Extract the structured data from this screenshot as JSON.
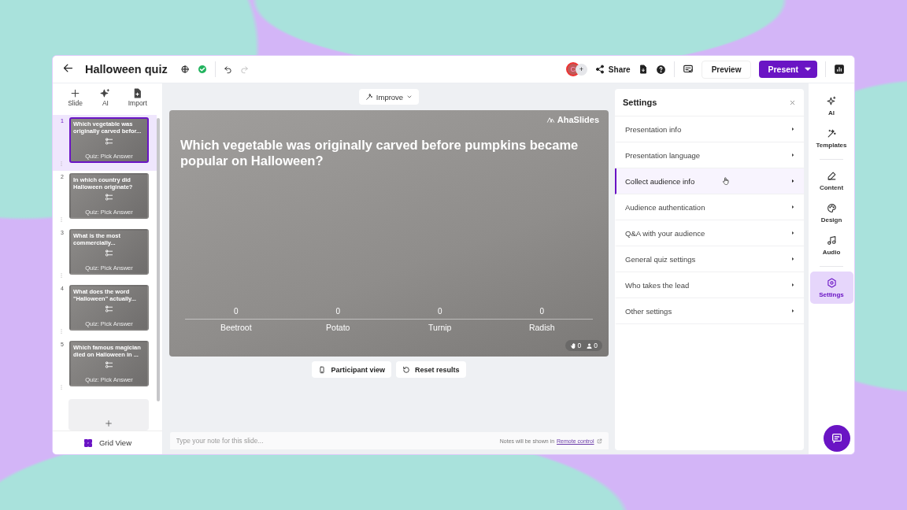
{
  "window": {
    "title": "Halloween quiz"
  },
  "toolbar": {
    "share": "Share",
    "preview": "Preview",
    "present": "Present",
    "avatar_initial": "C",
    "add_collaborator": "+"
  },
  "slide_tools": [
    "Slide",
    "AI",
    "Import"
  ],
  "slides": [
    {
      "number": "1",
      "title": "Which vegetable was originally carved befor...",
      "type": "Quiz: Pick Answer",
      "selected": true
    },
    {
      "number": "2",
      "title": "In which country did Halloween originate?",
      "type": "Quiz: Pick Answer",
      "selected": false
    },
    {
      "number": "3",
      "title": "What is the most commercially...",
      "type": "Quiz: Pick Answer",
      "selected": false
    },
    {
      "number": "4",
      "title": "What does the word \"Halloween\" actually...",
      "type": "Quiz: Pick Answer",
      "selected": false
    },
    {
      "number": "5",
      "title": "Which famous magician died on Halloween in ...",
      "type": "Quiz: Pick Answer",
      "selected": false
    }
  ],
  "grid_view": "Grid View",
  "improve": "Improve",
  "slide": {
    "question": "Which vegetable was originally carved before pumpkins became popular on Halloween?",
    "brand": "AhaSlides",
    "options": [
      {
        "label": "Beetroot",
        "count": "0"
      },
      {
        "label": "Potato",
        "count": "0"
      },
      {
        "label": "Turnip",
        "count": "0"
      },
      {
        "label": "Radish",
        "count": "0"
      }
    ],
    "reactions": "0",
    "participants": "0"
  },
  "stage_buttons": [
    "Participant view",
    "Reset results"
  ],
  "notes": {
    "placeholder": "Type your note for this slide...",
    "hint": "Notes will be shown in",
    "link": "Remote control"
  },
  "settings": {
    "title": "Settings",
    "items": [
      {
        "label": "Presentation info",
        "selected": false
      },
      {
        "label": "Presentation language",
        "selected": false
      },
      {
        "label": "Collect audience info",
        "selected": true
      },
      {
        "label": "Audience authentication",
        "selected": false
      },
      {
        "label": "Q&A with your audience",
        "selected": false
      },
      {
        "label": "General quiz settings",
        "selected": false
      },
      {
        "label": "Who takes the lead",
        "selected": false
      },
      {
        "label": "Other settings",
        "selected": false
      }
    ]
  },
  "rail": {
    "items": [
      {
        "kind": "ai",
        "label": "AI",
        "selected": false
      },
      {
        "kind": "templates",
        "label": "Templates",
        "selected": false
      },
      {
        "kind": "content",
        "label": "Content",
        "selected": false
      },
      {
        "kind": "design",
        "label": "Design",
        "selected": false
      },
      {
        "kind": "audio",
        "label": "Audio",
        "selected": false
      },
      {
        "kind": "settings",
        "label": "Settings",
        "selected": true
      }
    ]
  }
}
